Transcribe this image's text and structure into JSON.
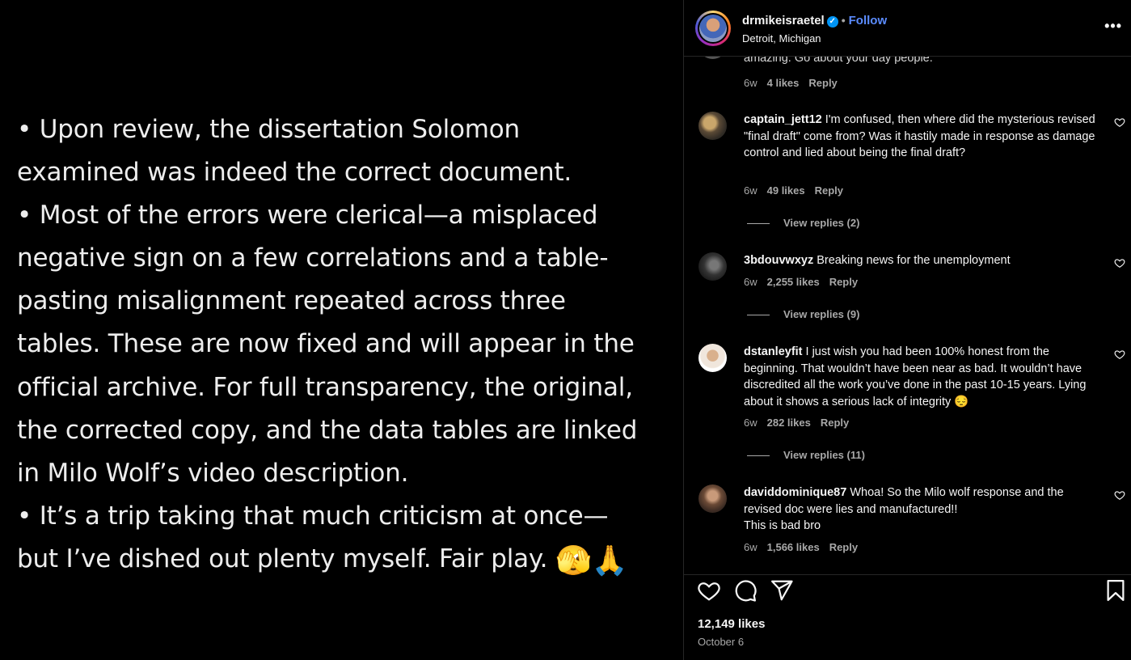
{
  "post": {
    "paragraphs": [
      "• Upon review, the dissertation Solomon examined was indeed the correct document.",
      "• Most of the errors were clerical—a misplaced negative sign on a few correlations and a table-pasting misalignment repeated across three tables. These are now fixed and will appear in the official archive. For full transparency, the original, the corrected copy, and the data tables are linked in Milo Wolf’s video description.",
      "• It’s a trip taking that much criticism at once—but I’ve dished out plenty myself. Fair play."
    ],
    "emojis": "🫣🙏"
  },
  "header": {
    "username": "drmikeisraetel",
    "verified_mark": "✓",
    "separator": "•",
    "follow_label": "Follow",
    "location": "Detroit, Michigan",
    "more_label": "•••"
  },
  "comments": {
    "partial": {
      "text": "amazing. Go about your day people.",
      "time": "6w",
      "likes": "4 likes",
      "reply": "Reply"
    },
    "items": [
      {
        "username": "captain_jett12",
        "text": "I'm confused, then where did the mysterious revised \"final draft\" come from? Was it hastily made in response as damage control and lied about being the final draft?",
        "time": "6w",
        "likes": "49 likes",
        "reply": "Reply",
        "view_replies": "View replies (2)"
      },
      {
        "username": "3bdouvwxyz",
        "text": "Breaking news for the unemployment",
        "time": "6w",
        "likes": "2,255 likes",
        "reply": "Reply",
        "view_replies": "View replies (9)"
      },
      {
        "username": "dstanleyfit",
        "text": "I just wish you had been 100% honest from the beginning. That wouldn’t have been near as bad. It wouldn’t have discredited all the work you’ve done in the past 10-15 years. Lying about it shows a serious lack of integrity 😔",
        "time": "6w",
        "likes": "282 likes",
        "reply": "Reply",
        "view_replies": "View replies (11)"
      },
      {
        "username": "daviddominique87",
        "text": "Whoa! So the Milo wolf response and the revised doc were lies and manufactured!!",
        "text2": "This is bad bro",
        "time": "6w",
        "likes": "1,566 likes",
        "reply": "Reply"
      }
    ]
  },
  "footer": {
    "likes": "12,149 likes",
    "date": "October 6"
  },
  "icons": [
    "heart-icon",
    "comment-icon",
    "share-icon",
    "bookmark-icon",
    "more-icon",
    "verified-icon"
  ]
}
